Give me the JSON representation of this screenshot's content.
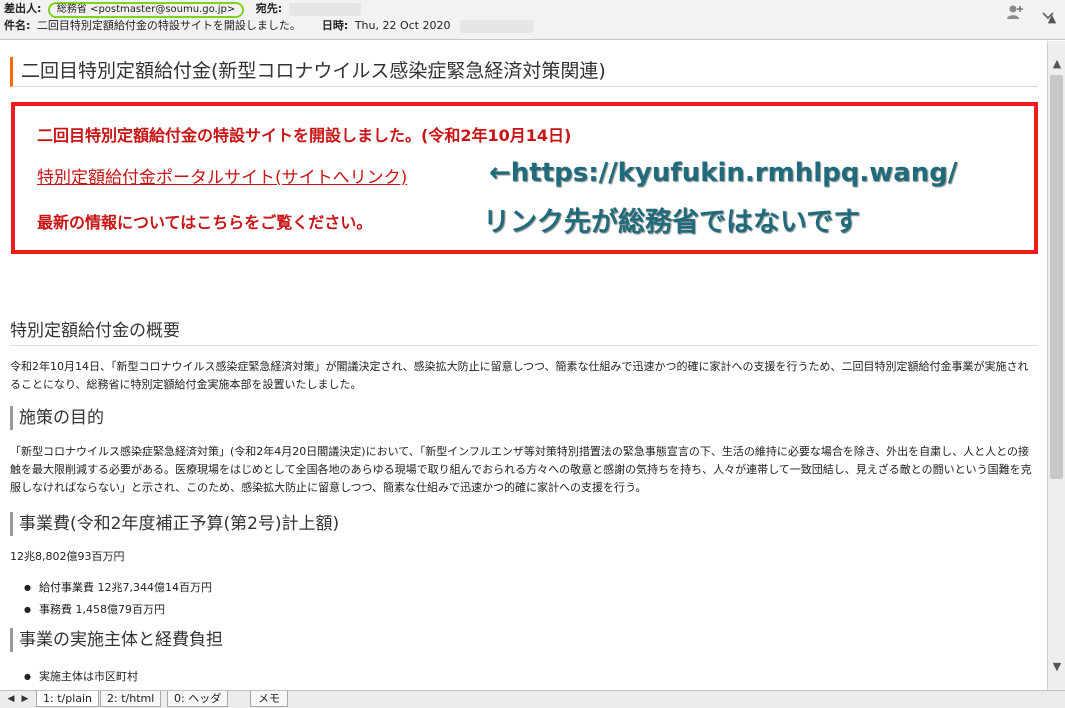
{
  "header": {
    "sender_label": "差出人:",
    "sender_value": "総務省 <postmaster@soumu.go.jp>",
    "to_label": "宛先:",
    "subject_label": "件名:",
    "subject_value": "二回目特別定額給付金の特設サイトを開設しました。",
    "date_label": "日時:",
    "date_value": "Thu, 22 Oct 2020",
    "sender_highlight_color": "#7ed321",
    "icons": [
      "add-contact-icon",
      "chevron-down-icon"
    ]
  },
  "content": {
    "page_title": "二回目特別定額給付金(新型コロナウイルス感染症緊急経済対策関連)",
    "alert": {
      "line1": "二回目特別定額給付金の特設サイトを開設しました。(令和2年10月14日)",
      "link": "特別定額給付金ポータルサイト(サイトへリンク)",
      "line3": "最新の情報についてはこちらをご覧ください。",
      "border_color": "#ee1c1c"
    },
    "annotation": {
      "url": "←https://kyufukin.rmhlpq.wang/",
      "warning": "リンク先が総務省ではないです"
    },
    "overview": {
      "heading": "特別定額給付金の概要",
      "text": "令和2年10月14日、「新型コロナウイルス感染症緊急経済対策」が閣議決定され、感染拡大防止に留意しつつ、簡素な仕組みで迅速かつ的確に家計への支援を行うため、二回目特別定額給付金事業が実施されることになり、総務省に特別定額給付金実施本部を設置いたしました。"
    },
    "purpose": {
      "heading": "施策の目的",
      "text": "「新型コロナウイルス感染症緊急経済対策」(令和2年4月20日閣議決定)において、「新型インフルエンザ等対策特別措置法の緊急事態宣言の下、生活の維持に必要な場合を除き、外出を自粛し、人と人との接触を最大限削減する必要がある。医療現場をはじめとして全国各地のあらゆる現場で取り組んでおられる方々への敬意と感謝の気持ちを持ち、人々が連帯して一致団結し、見えざる敵との闘いという国難を克服しなければならない」と示され、このため、感染拡大防止に留意しつつ、簡素な仕組みで迅速かつ的確に家計への支援を行う。"
    },
    "budget": {
      "heading": "事業費(令和2年度補正予算(第2号)計上額)",
      "total": "12兆8,802億93百万円",
      "items": [
        "給付事業費 12兆7,344億14百万円",
        "事務費 1,458億79百万円"
      ]
    },
    "implementer": {
      "heading": "事業の実施主体と経費負担",
      "items": [
        "実施主体は市区町村"
      ]
    }
  },
  "bottom_bar": {
    "tabs": [
      "1: t/plain",
      "2: t/html",
      "0: ヘッダ"
    ],
    "memo": "メモ",
    "nav_prev": "◀",
    "nav_next": "▶"
  }
}
